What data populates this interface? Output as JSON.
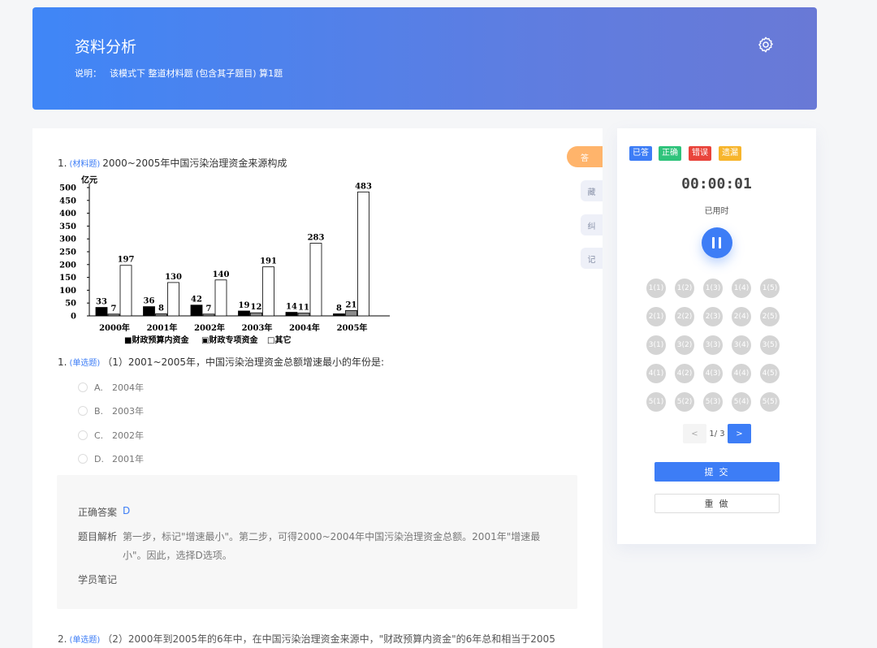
{
  "header": {
    "title": "资料分析",
    "desc_label": "说明：",
    "desc_text": "该模式下 整道材料题 (包含其子题目) 算1题",
    "settings_icon": "gear-icon"
  },
  "question": {
    "number": "1.",
    "tag": "(材料题)",
    "title": "2000~2005年中国污染治理资金来源构成"
  },
  "chart_data": {
    "type": "bar",
    "title": "",
    "ylabel": "亿元",
    "xlabel": "",
    "ylim": [
      0,
      500
    ],
    "yticks": [
      0,
      50,
      100,
      150,
      200,
      250,
      300,
      350,
      400,
      450,
      500
    ],
    "categories": [
      "2000年",
      "2001年",
      "2002年",
      "2003年",
      "2004年",
      "2005年"
    ],
    "series": [
      {
        "name": "财政预算内资金",
        "values": [
          33,
          36,
          42,
          19,
          14,
          8
        ],
        "color": "#000000"
      },
      {
        "name": "财政专项资金",
        "values": [
          7,
          8,
          7,
          12,
          11,
          21
        ],
        "color": "#8c8c8c"
      },
      {
        "name": "其它",
        "values": [
          197,
          130,
          140,
          191,
          283,
          483
        ],
        "color": "#ffffff"
      }
    ],
    "legend_position": "bottom",
    "grid": false
  },
  "legend_labels": [
    "■财政预算内资金",
    "▣财政专项资金",
    "□其它"
  ],
  "sub_question": {
    "number": "1.",
    "tag": "(单选题)",
    "text": "（1）2001~2005年，中国污染治理资金总额增速最小的年份是:"
  },
  "options": [
    {
      "letter": "A.",
      "text": "2004年"
    },
    {
      "letter": "B.",
      "text": "2003年"
    },
    {
      "letter": "C.",
      "text": "2002年"
    },
    {
      "letter": "D.",
      "text": "2001年"
    }
  ],
  "answer": {
    "correct_label": "正确答案",
    "correct_value": "D",
    "analysis_label": "题目解析",
    "analysis_text": "第一步，标记\"增速最小\"。第二步，可得2000~2004年中国污染治理资金总额。2001年\"增速最小\"。因此，选择D选项。",
    "notes_label": "学员笔记"
  },
  "next_question": {
    "number": "2.",
    "tag": "(单选题)",
    "text": "（2）2000年到2005年的6年中，在中国污染治理资金来源中，\"财政预算内资金\"的6年总和相当于2005"
  },
  "side_tabs": [
    "答",
    "藏",
    "纠",
    "记"
  ],
  "panel": {
    "legend": [
      {
        "label": "已答",
        "color": "#3d7df6"
      },
      {
        "label": "正确",
        "color": "#2fc37b"
      },
      {
        "label": "错误",
        "color": "#e9443b"
      },
      {
        "label": "遗漏",
        "color": "#f7b52c"
      }
    ],
    "timer": "00:00:01",
    "timer_label": "已用时",
    "pause_icon": "pause-icon",
    "questions": [
      "1(1)",
      "1(2)",
      "1(3)",
      "1(4)",
      "1(5)",
      "2(1)",
      "2(2)",
      "2(3)",
      "2(4)",
      "2(5)",
      "3(1)",
      "3(2)",
      "3(3)",
      "3(4)",
      "3(5)",
      "4(1)",
      "4(2)",
      "4(3)",
      "4(4)",
      "4(5)",
      "5(1)",
      "5(2)",
      "5(3)",
      "5(4)",
      "5(5)"
    ],
    "pager": {
      "prev": "<",
      "current": "1",
      "separator": "/",
      "total": "3",
      "next": ">"
    },
    "submit_label": "提 交",
    "redo_label": "重 做"
  }
}
